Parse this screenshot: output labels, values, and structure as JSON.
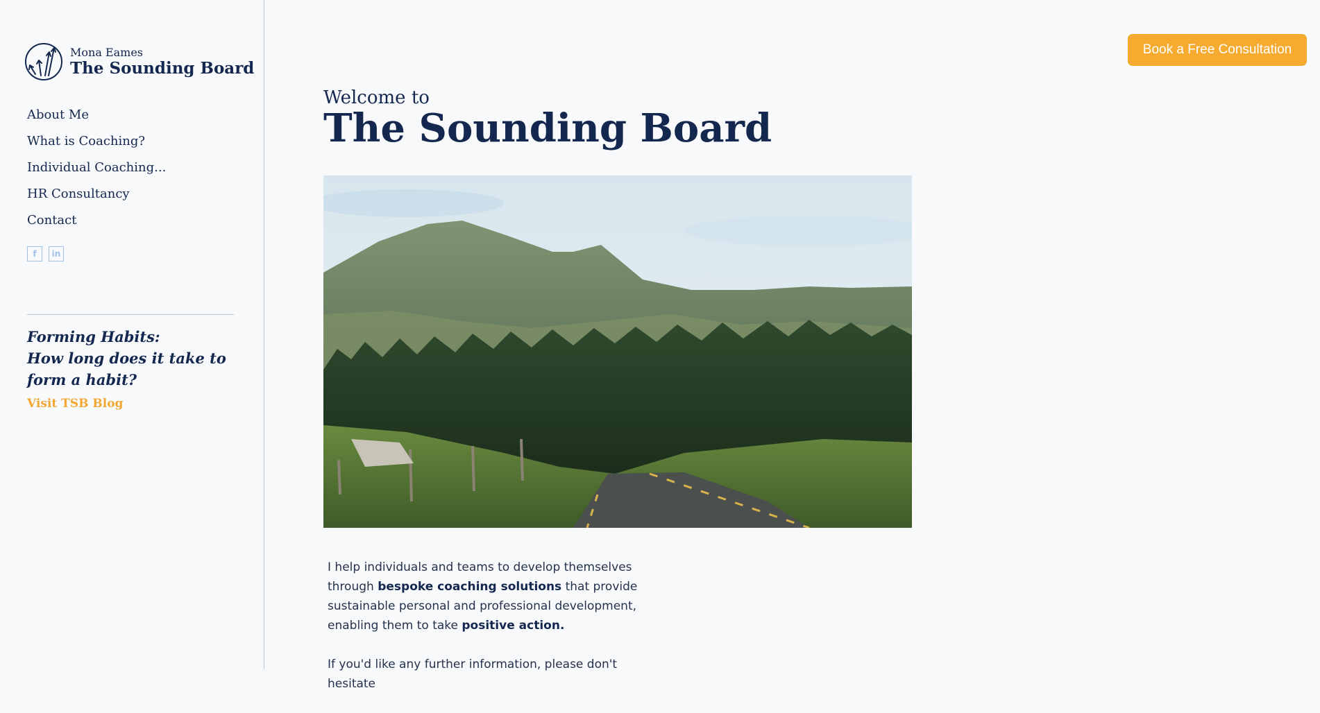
{
  "brand": {
    "name": "Mona Eames",
    "title": "The Sounding Board",
    "logo_icon": "arrows-circle-icon"
  },
  "nav": {
    "items": [
      {
        "label": "About Me"
      },
      {
        "label": "What is Coaching?"
      },
      {
        "label": "Individual Coaching..."
      },
      {
        "label": "HR Consultancy"
      },
      {
        "label": "Contact"
      }
    ]
  },
  "social": {
    "facebook": "f",
    "linkedin": "in",
    "icon_color": "#9fc3e7"
  },
  "blog": {
    "heading_line1": "Forming Habits:",
    "heading_line2": "How long does it take to form a habit?",
    "link_label": "Visit TSB Blog",
    "link_color": "#f2a733"
  },
  "header": {
    "cta_label": "Book a Free Consultation",
    "cta_color": "#f6aa2f"
  },
  "main": {
    "welcome": "Welcome to",
    "title": "The Sounding Board",
    "intro": {
      "p1_a": "I help individuals and teams to develop themselves through",
      "p1_b": "bespoke coaching solutions",
      "p1_c": "that provide sustainable personal and professional development, enabling them to take",
      "p1_d": "positive action.",
      "p2": "If you'd like any further information, please don't hesitate"
    }
  },
  "colors": {
    "navy": "#14274e",
    "background": "#f8f9fa",
    "accent": "#f6aa2f"
  }
}
